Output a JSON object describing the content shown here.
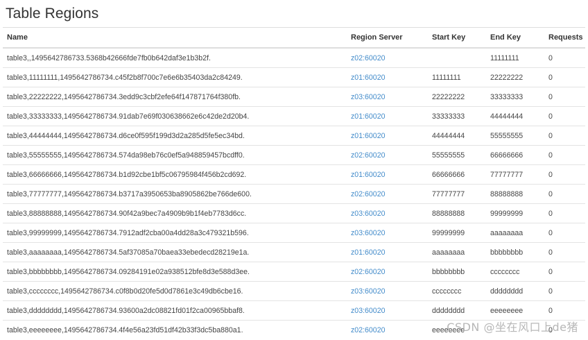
{
  "page": {
    "title": "Table Regions"
  },
  "table": {
    "headers": {
      "name": "Name",
      "region_server": "Region Server",
      "start_key": "Start Key",
      "end_key": "End Key",
      "requests": "Requests"
    },
    "rows": [
      {
        "name": "table3,,1495642786733.5368b42666fde7fb0b642daf3e1b3b2f.",
        "server": "z02:60020",
        "start": "",
        "end": "11111111",
        "requests": "0"
      },
      {
        "name": "table3,11111111,1495642786734.c45f2b8f700c7e6e6b35403da2c84249.",
        "server": "z01:60020",
        "start": "11111111",
        "end": "22222222",
        "requests": "0"
      },
      {
        "name": "table3,22222222,1495642786734.3edd9c3cbf2efe64f147871764f380fb.",
        "server": "z03:60020",
        "start": "22222222",
        "end": "33333333",
        "requests": "0"
      },
      {
        "name": "table3,33333333,1495642786734.91dab7e69f030638662e6c42de2d20b4.",
        "server": "z01:60020",
        "start": "33333333",
        "end": "44444444",
        "requests": "0"
      },
      {
        "name": "table3,44444444,1495642786734.d6ce0f595f199d3d2a285d5fe5ec34bd.",
        "server": "z01:60020",
        "start": "44444444",
        "end": "55555555",
        "requests": "0"
      },
      {
        "name": "table3,55555555,1495642786734.574da98eb76c0ef5a948859457bcdff0.",
        "server": "z02:60020",
        "start": "55555555",
        "end": "66666666",
        "requests": "0"
      },
      {
        "name": "table3,66666666,1495642786734.b1d92cbe1bf5c06795984f456b2cd692.",
        "server": "z01:60020",
        "start": "66666666",
        "end": "77777777",
        "requests": "0"
      },
      {
        "name": "table3,77777777,1495642786734.b3717a3950653ba8905862be766de600.",
        "server": "z02:60020",
        "start": "77777777",
        "end": "88888888",
        "requests": "0"
      },
      {
        "name": "table3,88888888,1495642786734.90f42a9bec7a4909b9b1f4eb7783d6cc.",
        "server": "z03:60020",
        "start": "88888888",
        "end": "99999999",
        "requests": "0"
      },
      {
        "name": "table3,99999999,1495642786734.7912adf2cba00a4dd28a3c479321b596.",
        "server": "z03:60020",
        "start": "99999999",
        "end": "aaaaaaaa",
        "requests": "0"
      },
      {
        "name": "table3,aaaaaaaa,1495642786734.5af37085a70baea33ebedecd28219e1a.",
        "server": "z01:60020",
        "start": "aaaaaaaa",
        "end": "bbbbbbbb",
        "requests": "0"
      },
      {
        "name": "table3,bbbbbbbb,1495642786734.09284191e02a938512bfe8d3e588d3ee.",
        "server": "z02:60020",
        "start": "bbbbbbbb",
        "end": "cccccccc",
        "requests": "0"
      },
      {
        "name": "table3,cccccccc,1495642786734.c0f8b0d20fe5d0d7861e3c49db6cbe16.",
        "server": "z03:60020",
        "start": "cccccccc",
        "end": "dddddddd",
        "requests": "0"
      },
      {
        "name": "table3,dddddddd,1495642786734.93600a2dc08821fd01f2ca00965bbaf8.",
        "server": "z03:60020",
        "start": "dddddddd",
        "end": "eeeeeeee",
        "requests": "0"
      },
      {
        "name": "table3,eeeeeeee,1495642786734.4f4e56a23fd51df42b33f3dc5ba880a1.",
        "server": "z02:60020",
        "start": "eeeeeeee",
        "end": "",
        "requests": "0"
      }
    ]
  },
  "watermark": "CSDN @坐在风口上de猪",
  "colors": {
    "link": "#428bca",
    "text": "#333333",
    "border": "#dddddd"
  }
}
